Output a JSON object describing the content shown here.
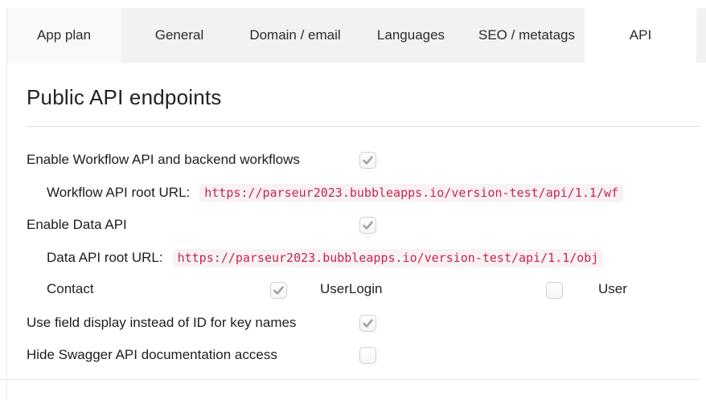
{
  "tabs": [
    {
      "label": "App plan"
    },
    {
      "label": "General"
    },
    {
      "label": "Domain / email"
    },
    {
      "label": "Languages"
    },
    {
      "label": "SEO / metatags"
    },
    {
      "label": "API",
      "active": true
    }
  ],
  "heading": {
    "title": "Public API endpoints"
  },
  "settings": {
    "enable_workflow_api": {
      "label": "Enable Workflow API and backend workflows",
      "checked": true
    },
    "workflow_root_url": {
      "label": "Workflow API root URL:",
      "value": "https://parseur2023.bubbleapps.io/version-test/api/1.1/wf"
    },
    "enable_data_api": {
      "label": "Enable Data API",
      "checked": true
    },
    "data_root_url": {
      "label": "Data API root URL:",
      "value": "https://parseur2023.bubbleapps.io/version-test/api/1.1/obj"
    },
    "data_types": [
      {
        "label": "Contact",
        "checked": true
      },
      {
        "label": "UserLogin",
        "checked": false
      },
      {
        "label": "User"
      }
    ],
    "use_field_display": {
      "label": "Use field display instead of ID for key names",
      "checked": true
    },
    "hide_swagger": {
      "label": "Hide Swagger API documentation access",
      "checked": false
    }
  },
  "colors": {
    "code_text": "#c7254e",
    "code_bg": "#f9f2f4",
    "check_mark": "#a3a3a3",
    "tab_bar_bg": "#f3f2f1",
    "active_tab_bg": "#ffffff"
  }
}
